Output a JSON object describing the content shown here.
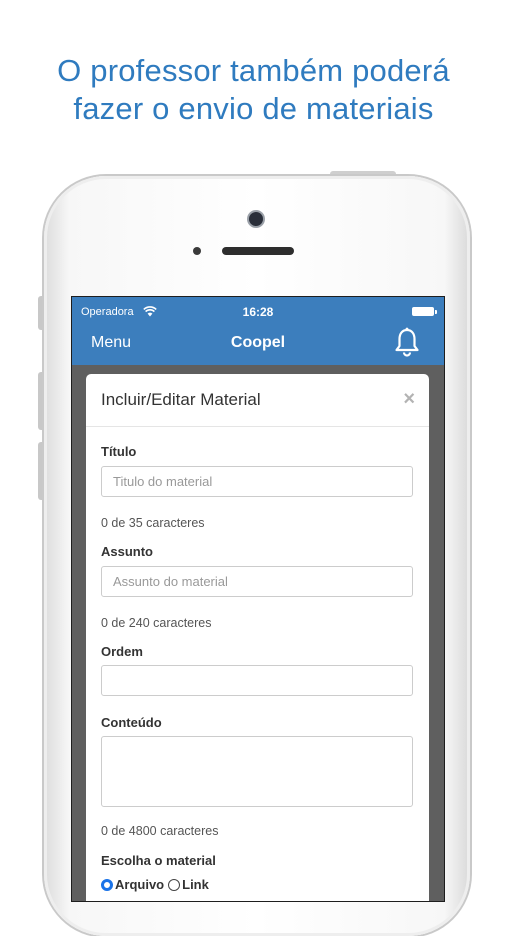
{
  "headline": {
    "line1": "O professor também poderá",
    "line2": "fazer o envio de materiais"
  },
  "status_bar": {
    "carrier": "Operadora",
    "time": "16:28"
  },
  "app_bar": {
    "menu_label": "Menu",
    "title": "Coopel",
    "color": "#3c7ebd"
  },
  "modal": {
    "title": "Incluir/Editar Material",
    "close_label": "×",
    "fields": {
      "titulo": {
        "label": "Título",
        "value": "",
        "placeholder": "Titulo do material",
        "counter": "0 de 35 caracteres"
      },
      "assunto": {
        "label": "Assunto",
        "value": "",
        "placeholder": "Assunto do material",
        "counter": "0 de 240 caracteres"
      },
      "ordem": {
        "label": "Ordem",
        "value": ""
      },
      "conteudo": {
        "label": "Conteúdo",
        "value": "",
        "counter": "0 de 4800 caracteres"
      }
    },
    "material_type": {
      "label": "Escolha o material",
      "options": [
        "Arquivo",
        "Link"
      ],
      "selected": "Arquivo"
    }
  }
}
